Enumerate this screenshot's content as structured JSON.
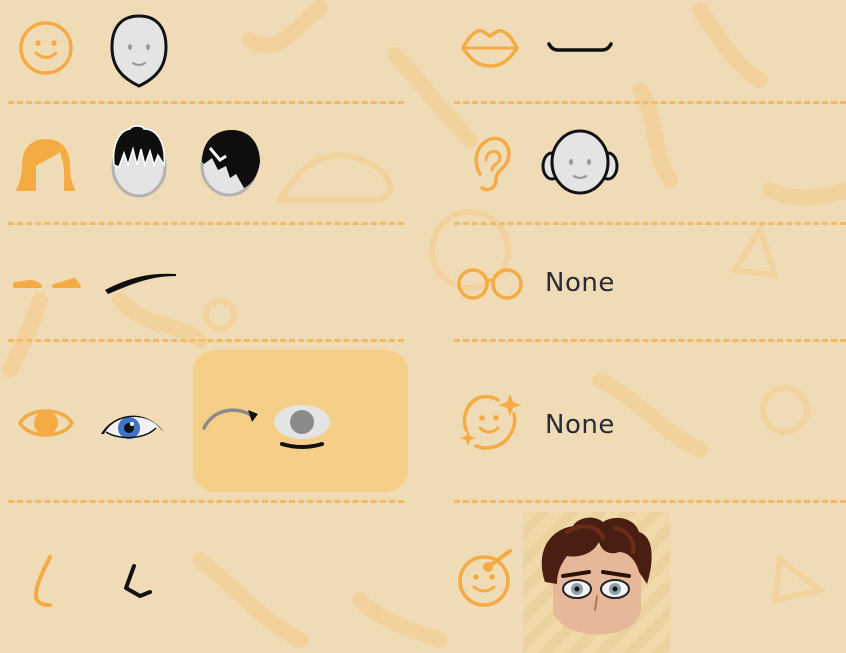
{
  "colors": {
    "background": "#efdcb7",
    "accent": "#f4ab43",
    "divider": "#f4ba63",
    "selected_bg": "#f5cf88",
    "text": "#2a2a30"
  },
  "categories": {
    "face_shape": {
      "icon": "face-icon",
      "options": [
        "face-shape-option"
      ]
    },
    "hair": {
      "icon": "hair-icon",
      "options": [
        "spiky-hair-option",
        "swoop-hair-option"
      ]
    },
    "eyebrows": {
      "icon": "eyebrows-icon",
      "options": [
        "arched-brow-option"
      ]
    },
    "eyes": {
      "icon": "eye-icon",
      "options": [
        "blue-eye-option",
        "eye-color-shift-option"
      ]
    },
    "nose": {
      "icon": "nose-icon",
      "options": [
        "angled-nose-option"
      ]
    },
    "mouth": {
      "icon": "lips-icon",
      "options": [
        "flat-mouth-option"
      ]
    },
    "ears": {
      "icon": "ear-icon",
      "options": [
        "ears-option"
      ]
    },
    "glasses": {
      "icon": "glasses-icon",
      "value": "None"
    },
    "face_details": {
      "icon": "sparkle-face-icon",
      "value": "None"
    },
    "preview": {
      "icon": "wand-face-icon"
    }
  }
}
